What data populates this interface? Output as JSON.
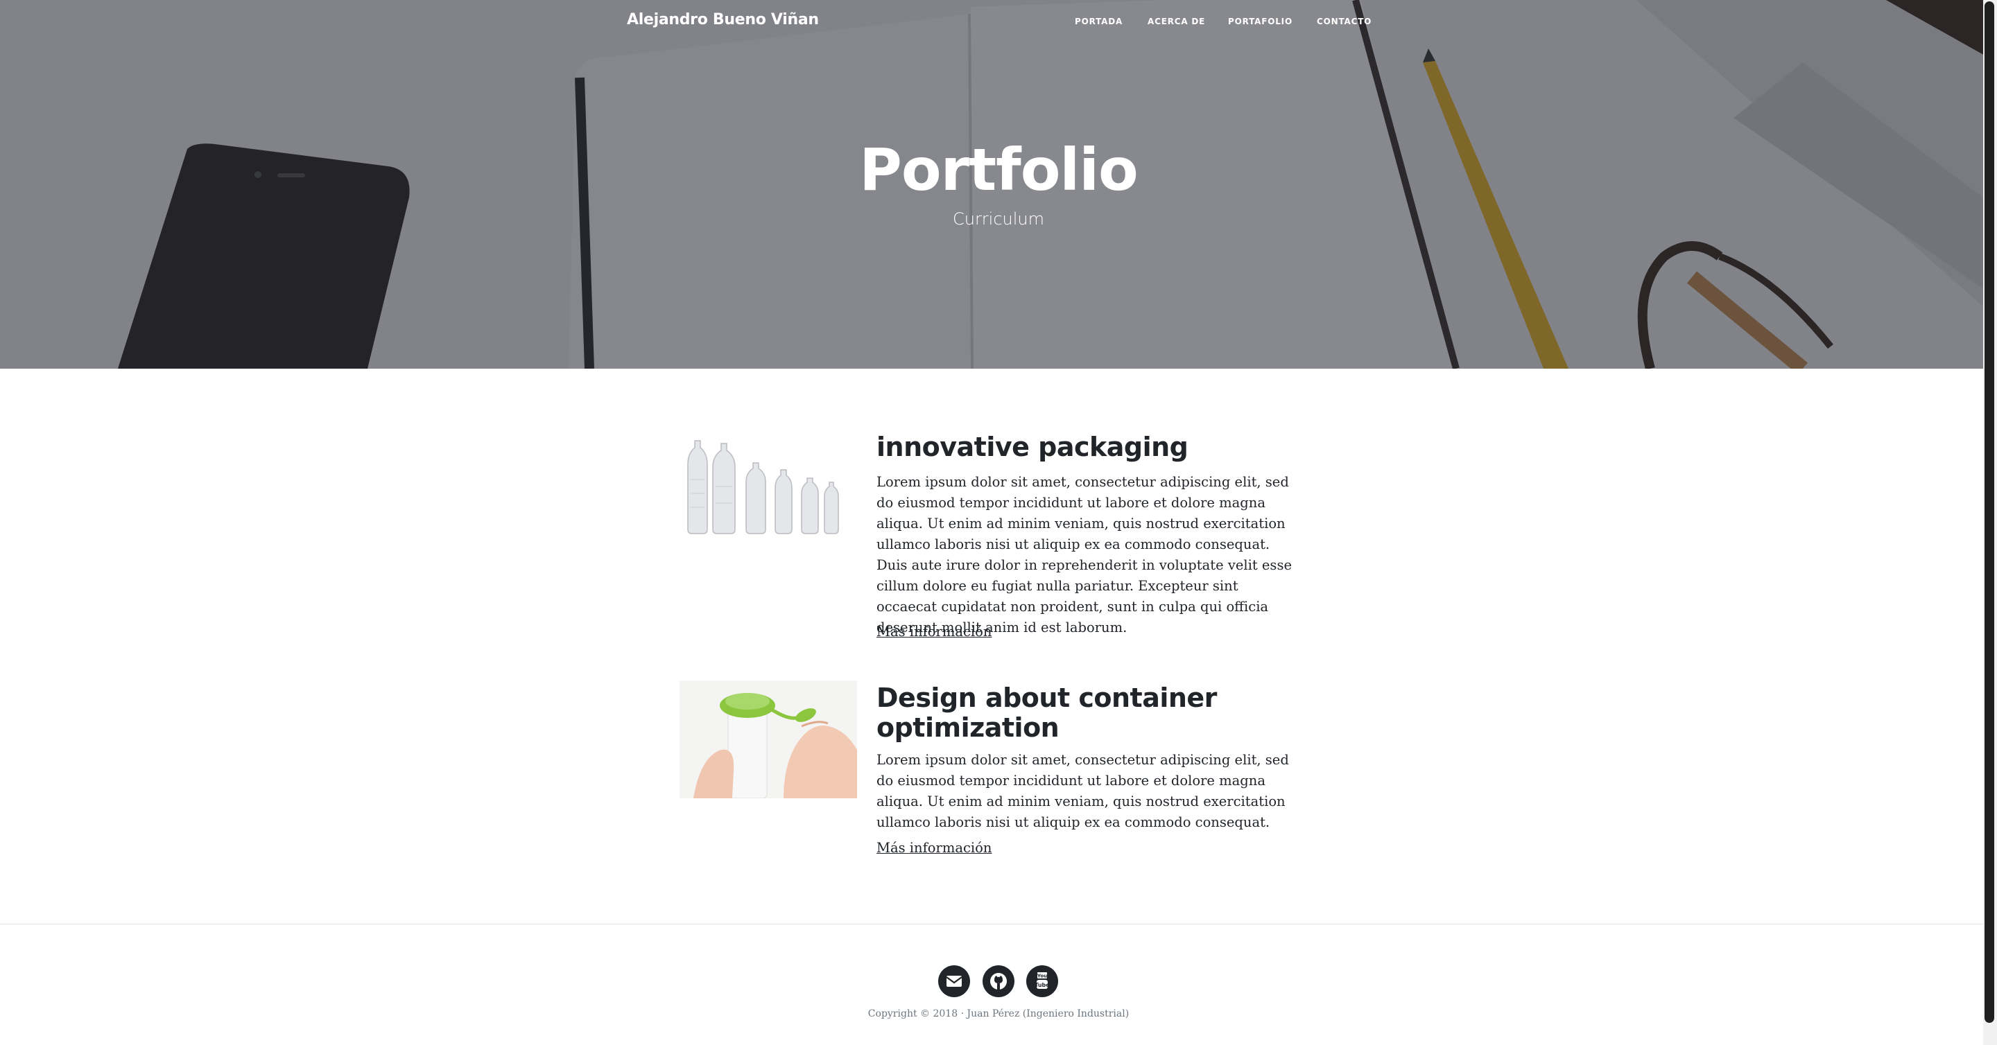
{
  "navbar": {
    "brand": "Alejandro Bueno Viñan",
    "items": [
      "PORTADA",
      "ACERCA DE",
      "PORTAFOLIO",
      "CONTACTO"
    ]
  },
  "hero": {
    "title": "Portfolio",
    "subtitle": "Curriculum"
  },
  "posts": [
    {
      "title": "innovative packaging",
      "body": "Lorem ipsum dolor sit amet, consectetur adipiscing elit, sed do eiusmod tempor incididunt ut labore et dolore magna aliqua. Ut enim ad minim veniam, quis nostrud exercitation ullamco laboris nisi ut aliquip ex ea commodo consequat. Duis aute irure dolor in reprehenderit in voluptate velit esse cillum dolore eu fugiat nulla pariatur. Excepteur sint occaecat cupidatat non proident, sunt in culpa qui officia deserunt mollit anim id est laborum.",
      "link": "Más información"
    },
    {
      "title": "Design about container optimization",
      "body": "Lorem ipsum dolor sit amet, consectetur adipiscing elit, sed do eiusmod tempor incididunt ut labore et dolore magna aliqua. Ut enim ad minim veniam, quis nostrud exercitation ullamco laboris nisi ut aliquip ex ea commodo consequat.",
      "link": "Más información"
    }
  ],
  "footer": {
    "social": [
      "envelope-icon",
      "github-icon",
      "youtube-icon"
    ],
    "copyright": "Copyright © 2018 · Juan Pérez (Ingeniero Industrial)"
  },
  "colors": {
    "text": "#212529",
    "overlay": "#1e2028",
    "muted": "#6c757d",
    "accent_green": "#8cc63f"
  }
}
